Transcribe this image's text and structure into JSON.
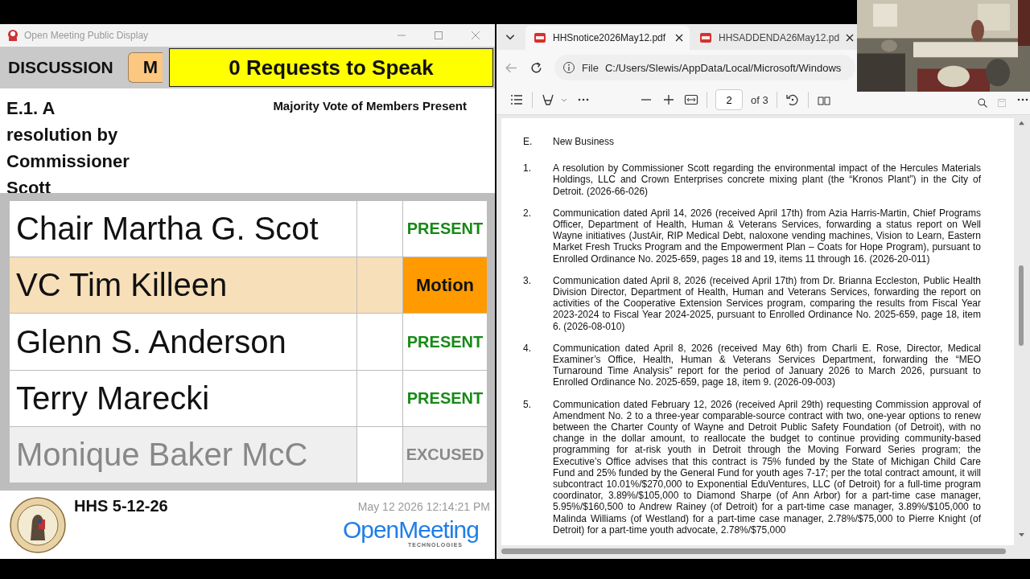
{
  "left_window": {
    "title": "Open Meeting Public Display",
    "mode": "DISCUSSION",
    "mode_button": "M",
    "requests": "0 Requests to Speak",
    "item_title": "E.1. A resolution by Commissioner Scott",
    "vote_rule": "Majority Vote of Members Present",
    "members": [
      {
        "name": "Chair Martha G. Scot",
        "status": "PRESENT",
        "kind": "present",
        "selected": false
      },
      {
        "name": "VC Tim Killeen",
        "status": "Motion",
        "kind": "motion",
        "selected": true
      },
      {
        "name": "Glenn S. Anderson",
        "status": "PRESENT",
        "kind": "present",
        "selected": false
      },
      {
        "name": "Terry Marecki",
        "status": "PRESENT",
        "kind": "present",
        "selected": false
      },
      {
        "name": "Monique Baker McC",
        "status": "EXCUSED",
        "kind": "excused",
        "selected": false
      }
    ],
    "meeting": "HHS 5-12-26",
    "timestamp": "May 12 2026 12:14:21 PM",
    "logo": {
      "name": "OpenMeeting",
      "tagline": "TECHNOLOGIES"
    }
  },
  "browser": {
    "tabs": [
      {
        "label": "HHSnotice2026May12.pdf",
        "selected": true
      },
      {
        "label": "HHSADDENDA26May12.pd",
        "selected": false
      }
    ],
    "address": {
      "scheme": "File",
      "url": "C:/Users/Slewis/AppData/Local/Microsoft/Windows"
    },
    "pdf_toolbar": {
      "page": "2",
      "page_count": "of 3"
    },
    "document": {
      "section_number": "E.",
      "section_title": "New Business",
      "items": [
        {
          "number": "1.",
          "text": "A resolution by Commissioner Scott regarding the environmental impact of the Hercules Materials Holdings, LLC and Crown Enterprises concrete mixing plant (the “Kronos Plant”) in the City of Detroit. (2026-66-026)"
        },
        {
          "number": "2.",
          "text": "Communication dated April 14, 2026 (received April 17th) from Azia Harris-Martin, Chief Programs Officer, Department of Health, Human & Veterans Services, forwarding a status report on Well Wayne initiatives (JustAir, RIP Medical Debt, naloxone vending machines, Vision to Learn, Eastern Market Fresh Trucks Program and the Empowerment Plan – Coats for Hope Program), pursuant to Enrolled Ordinance No. 2025-659, pages 18 and 19, items 11 through 16. (2026-20-011)"
        },
        {
          "number": "3.",
          "text": "Communication dated April 8, 2026 (received April 17th) from Dr. Brianna Eccleston, Public Health Division Director, Department of Health, Human and Veterans Services, forwarding the report on activities of the Cooperative Extension Services program, comparing the results from Fiscal Year 2023-2024 to Fiscal Year 2024-2025, pursuant to Enrolled Ordinance No. 2025-659, page 18, item 6. (2026-08-010)"
        },
        {
          "number": "4.",
          "text": "Communication dated April 8, 2026 (received May 6th) from Charli E. Rose, Director, Medical Examiner’s Office, Health, Human & Veterans Services Department, forwarding the “MEO Turnaround Time Analysis” report for the period of January 2026 to March 2026, pursuant to Enrolled Ordinance No. 2025-659, page 18, item 9. (2026-09-003)"
        },
        {
          "number": "5.",
          "text": "Communication dated February 12, 2026 (received April 29th) requesting Commission approval of Amendment No. 2 to a three-year comparable-source contract with two, one-year options to renew between the Charter County of Wayne and Detroit Public Safety Foundation (of Detroit), with no change in the dollar amount, to reallocate the budget to continue providing community-based programming for at-risk youth in Detroit through the Moving Forward Series program; the Executive’s Office advises that this contract is 75% funded by the State of Michigan Child Care Fund and 25% funded by the General Fund for youth ages 7-17; per the total contract amount, it will subcontract 10.01%/$270,000 to Exponential EduVentures, LLC (of Detroit) for a full-time program coordinator, 3.89%/$105,000 to Diamond Sharpe (of Ann Arbor) for a part-time case manager, 5.95%/$160,500 to Andrew Rainey (of Detroit) for a part-time case manager, 3.89%/$105,000 to Malinda Williams (of Westland) for a part-time case manager, 2.78%/$75,000 to Pierre Knight (of Detroit) for a part-time youth advocate, 2.78%/$75,000"
        }
      ]
    }
  }
}
